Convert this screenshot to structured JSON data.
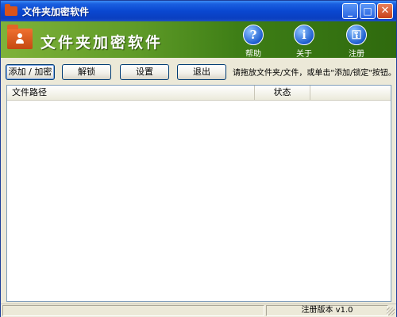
{
  "window": {
    "title": "文件夹加密软件"
  },
  "banner": {
    "title": "文件夹加密软件",
    "icons": [
      {
        "glyph": "?",
        "label": "帮助"
      },
      {
        "glyph": "i",
        "label": "关于"
      },
      {
        "glyph": "⚿",
        "label": "注册"
      }
    ]
  },
  "toolbar": {
    "add_lock_label": "添加 / 加密",
    "unlock_label": "解锁",
    "settings_label": "设置",
    "exit_label": "退出",
    "hint": "请拖放文件夹/文件，或单击\"添加/锁定\"按钮。"
  },
  "list": {
    "columns": [
      "文件路径",
      "状态"
    ],
    "rows": []
  },
  "statusbar": {
    "version": "注册版本 v1.0"
  },
  "colors": {
    "title_blue": "#0a47d0",
    "banner_green": "#5e9a27",
    "folder_orange": "#e06626",
    "icon_blue": "#1f5fd0"
  }
}
